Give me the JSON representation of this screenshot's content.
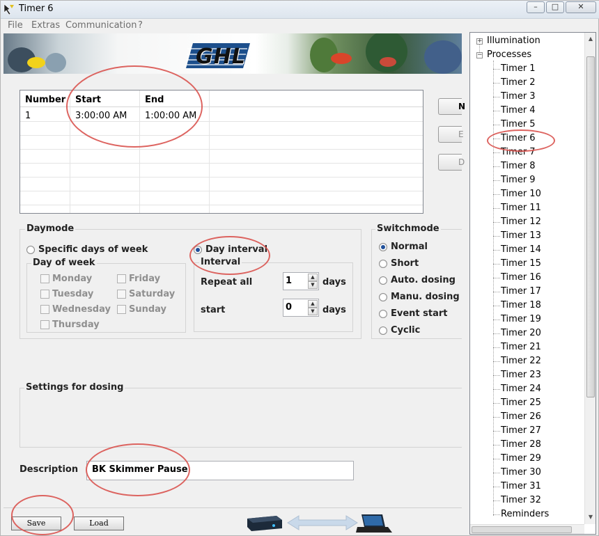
{
  "window": {
    "title": "Timer 6",
    "minimize": "–",
    "maximize": "□",
    "close": "✕"
  },
  "menu": [
    "File",
    "Extras",
    "Communication",
    "?"
  ],
  "banner": {
    "logo_text": "GHL"
  },
  "table": {
    "headers": [
      "Number",
      "Start",
      "End"
    ],
    "rows": [
      {
        "number": "1",
        "start": "3:00:00 AM",
        "end": "1:00:00 AM"
      }
    ]
  },
  "side_buttons": [
    "N",
    "E",
    "D"
  ],
  "daymode": {
    "label": "Daymode",
    "specific_days_label": "Specific days of week",
    "day_of_week_label": "Day of week",
    "days": [
      "Monday",
      "Tuesday",
      "Wednesday",
      "Thursday",
      "Friday",
      "Saturday",
      "Sunday"
    ],
    "day_interval_label": "Day interval",
    "interval_label": "Interval",
    "repeat_all_label": "Repeat all",
    "repeat_all_value": "1",
    "start_label": "start",
    "start_value": "0",
    "days_unit": "days",
    "selected": "Day interval"
  },
  "switchmode": {
    "label": "Switchmode",
    "options": [
      "Normal",
      "Short",
      "Auto. dosing",
      "Manu. dosing",
      "Event start",
      "Cyclic"
    ],
    "selected": "Normal"
  },
  "dosing": {
    "label": "Settings for dosing"
  },
  "description": {
    "label": "Description",
    "value": "BK Skimmer Pause"
  },
  "buttons": {
    "save": "Save",
    "load": "Load"
  },
  "tree": {
    "illumination": "Illumination",
    "processes": "Processes",
    "timers": [
      "Timer 1",
      "Timer 2",
      "Timer 3",
      "Timer 4",
      "Timer 5",
      "Timer 6",
      "Timer 7",
      "Timer 8",
      "Timer 9",
      "Timer 10",
      "Timer 11",
      "Timer 12",
      "Timer 13",
      "Timer 14",
      "Timer 15",
      "Timer 16",
      "Timer 17",
      "Timer 18",
      "Timer 19",
      "Timer 20",
      "Timer 21",
      "Timer 22",
      "Timer 23",
      "Timer 24",
      "Timer 25",
      "Timer 26",
      "Timer 27",
      "Timer 28",
      "Timer 29",
      "Timer 30",
      "Timer 31",
      "Timer 32"
    ],
    "reminders": "Reminders"
  },
  "colors": {
    "annotation": "#d9534f",
    "radio_selected": "#1f4f9a"
  }
}
